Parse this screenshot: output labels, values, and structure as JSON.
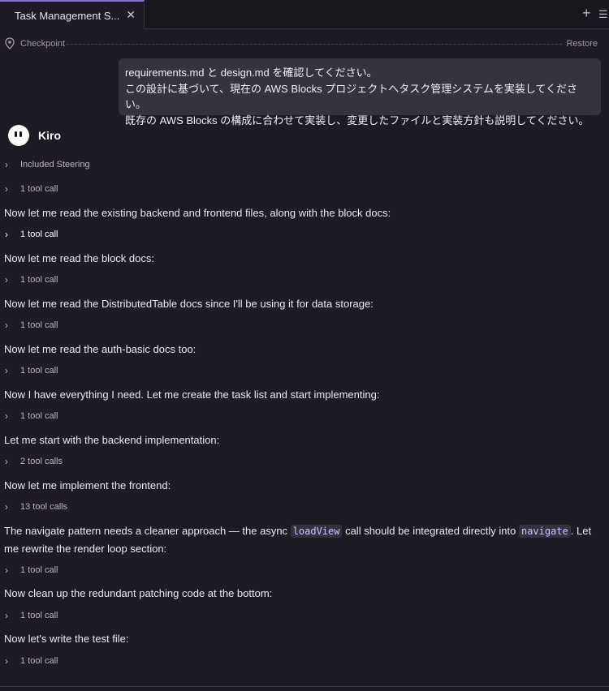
{
  "tab": {
    "title": "Task Management S...",
    "close": "✕"
  },
  "toolbar": {
    "add": "+",
    "list": "☰"
  },
  "checkpoint": {
    "label": "Checkpoint",
    "restore": "Restore"
  },
  "user_message": {
    "line1": "requirements.md と design.md を確認してください。",
    "line2": "この設計に基づいて、現在の AWS Blocks プロジェクトへタスク管理システムを実装してください。",
    "line3": "既存の AWS Blocks の構成に合わせて実装し、変更したファイルと実装方針も説明してください。"
  },
  "assistant": {
    "name": "Kiro"
  },
  "transcript": {
    "steering": "Included Steering",
    "call1": "1 tool call",
    "msg1": "Now let me read the existing backend and frontend files, along with the block docs:",
    "call2": "1 tool call",
    "msg2": "Now let me read the block docs:",
    "call3": "1 tool call",
    "msg3": "Now let me read the DistributedTable docs since I'll be using it for data storage:",
    "call4": "1 tool call",
    "msg4": "Now let me read the auth-basic docs too:",
    "call5": "1 tool call",
    "msg5": "Now I have everything I need. Let me create the task list and start implementing:",
    "call6": "1 tool call",
    "msg6": "Let me start with the backend implementation:",
    "call7": "2 tool calls",
    "msg7": "Now let me implement the frontend:",
    "call8": "13 tool calls",
    "msg8": {
      "part1": "The navigate pattern needs a cleaner approach — the async ",
      "code1": "loadView",
      "part2": " call should be integrated directly into ",
      "code2": "navigate",
      "part3": ". Let me rewrite the render loop section:"
    },
    "call9": "1 tool call",
    "msg9": "Now clean up the redundant patching code at the bottom:",
    "call10": "1 tool call",
    "msg10": "Now let's write the test file:",
    "call11": "1 tool call"
  },
  "colors": {
    "accent": "#8b6cf0",
    "background": "#1e1b24",
    "bubble": "#36333c"
  },
  "icons": {
    "tab_close": "close-icon",
    "new": "plus-icon",
    "menu": "list-icon",
    "checkpoint": "location-pin-icon",
    "expand": "chevron-right-icon"
  }
}
